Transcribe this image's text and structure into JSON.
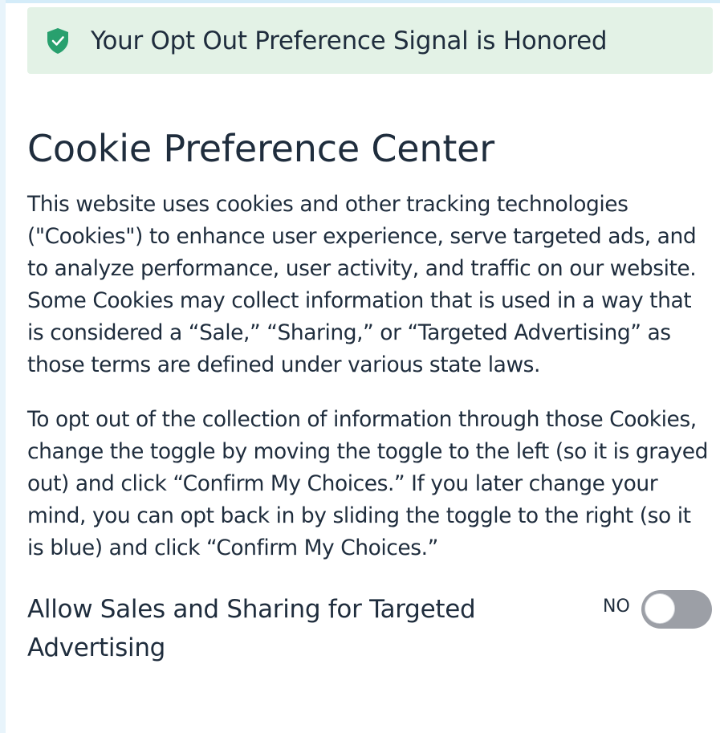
{
  "banner": {
    "icon": "shield-check-icon",
    "icon_color": "#28a06e",
    "text": "Your Opt Out Preference Signal is Honored"
  },
  "title": "Cookie Preference Center",
  "description": [
    "This website uses cookies and other tracking technologies (\"Cookies\") to enhance user experience, serve targeted ads, and to analyze performance, user activity, and traffic on our website. Some Cookies may collect information that is used in a way that is considered a “Sale,” “Sharing,” or “Targeted Advertising” as those terms are defined under various state laws.",
    "To opt out of the collection of information through those Cookies, change the toggle by moving the toggle to the left (so it is grayed out) and click “Confirm My Choices.” If you later change your mind, you can opt back in by sliding the toggle to the right (so it is blue) and click “Confirm My Choices.”"
  ],
  "toggle": {
    "label": "Allow Sales and Sharing for Targeted Advertising",
    "state_label": "NO",
    "checked": false
  },
  "colors": {
    "banner_bg": "#e3f2e6",
    "text": "#1f2d3d",
    "toggle_off": "#9c9fa6"
  }
}
